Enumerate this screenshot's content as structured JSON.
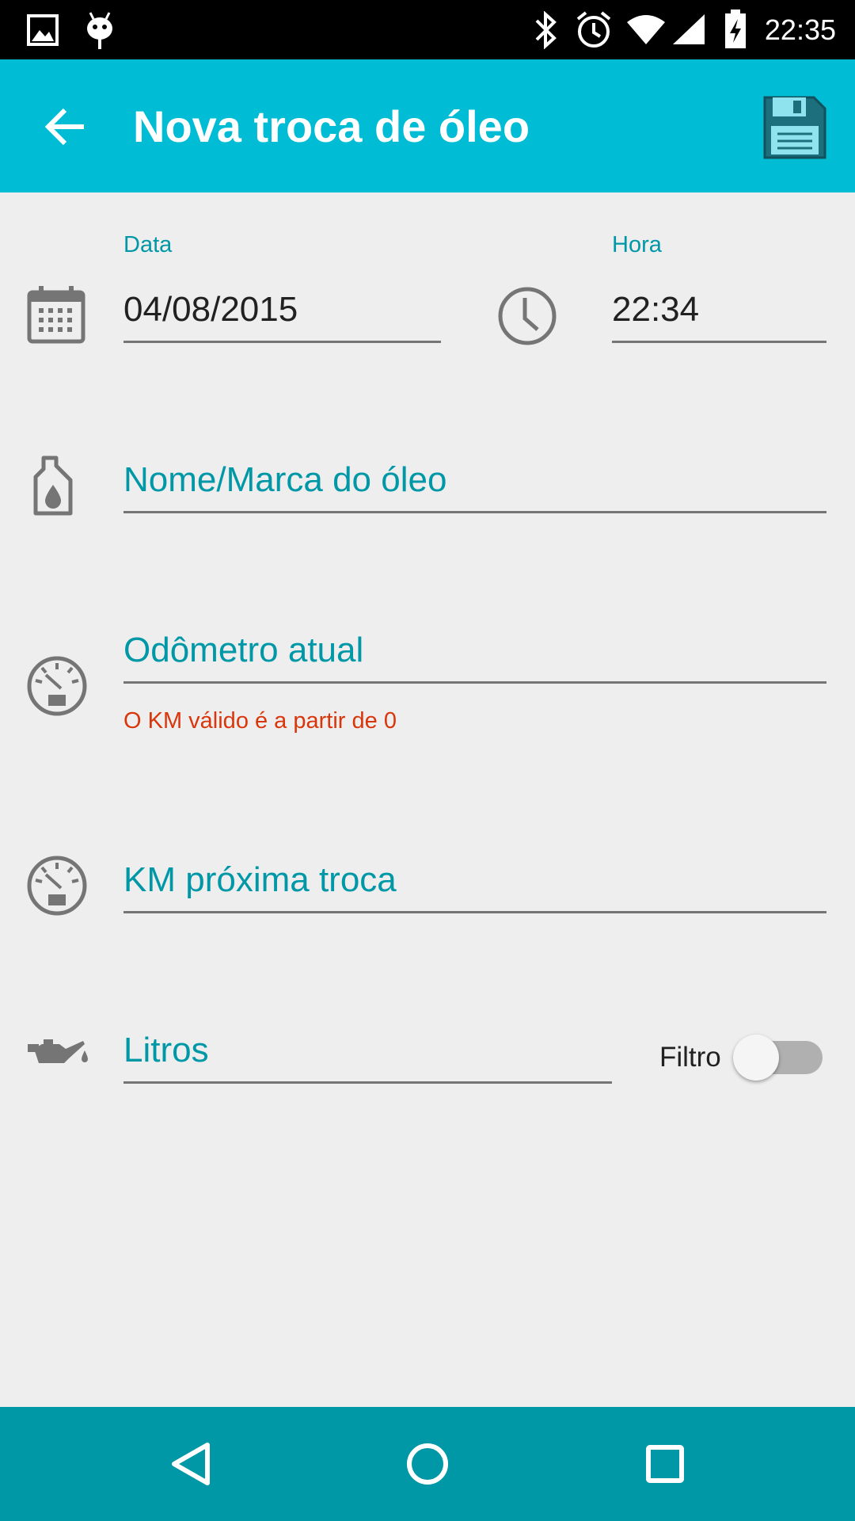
{
  "status_bar": {
    "time": "22:35",
    "icons": [
      "image-icon",
      "android-icon",
      "bluetooth-icon",
      "alarm-icon",
      "wifi-icon",
      "signal-icon",
      "battery-charging-icon"
    ]
  },
  "app_bar": {
    "title": "Nova troca de óleo",
    "back_icon": "arrow-back-icon",
    "save_icon": "floppy-disk-icon"
  },
  "form": {
    "date": {
      "label": "Data",
      "value": "04/08/2015",
      "icon": "calendar-icon"
    },
    "time": {
      "label": "Hora",
      "value": "22:34",
      "icon": "clock-icon"
    },
    "oil_name": {
      "placeholder": "Nome/Marca do óleo",
      "icon": "oil-bottle-icon"
    },
    "odometer": {
      "placeholder": "Odômetro atual",
      "error": "O KM válido é a partir de 0",
      "icon": "gauge-icon"
    },
    "next_change_km": {
      "placeholder": "KM próxima troca",
      "icon": "gauge-icon"
    },
    "liters": {
      "placeholder": "Litros",
      "icon": "oil-can-icon"
    },
    "filter": {
      "label": "Filtro",
      "checked": false
    }
  },
  "colors": {
    "accent": "#00bcd4",
    "accent_dark": "#0097a7",
    "error": "#d9360c",
    "background": "#eeeeee"
  },
  "nav_bar": {
    "buttons": [
      "back-triangle-icon",
      "home-circle-icon",
      "recents-square-icon"
    ]
  }
}
